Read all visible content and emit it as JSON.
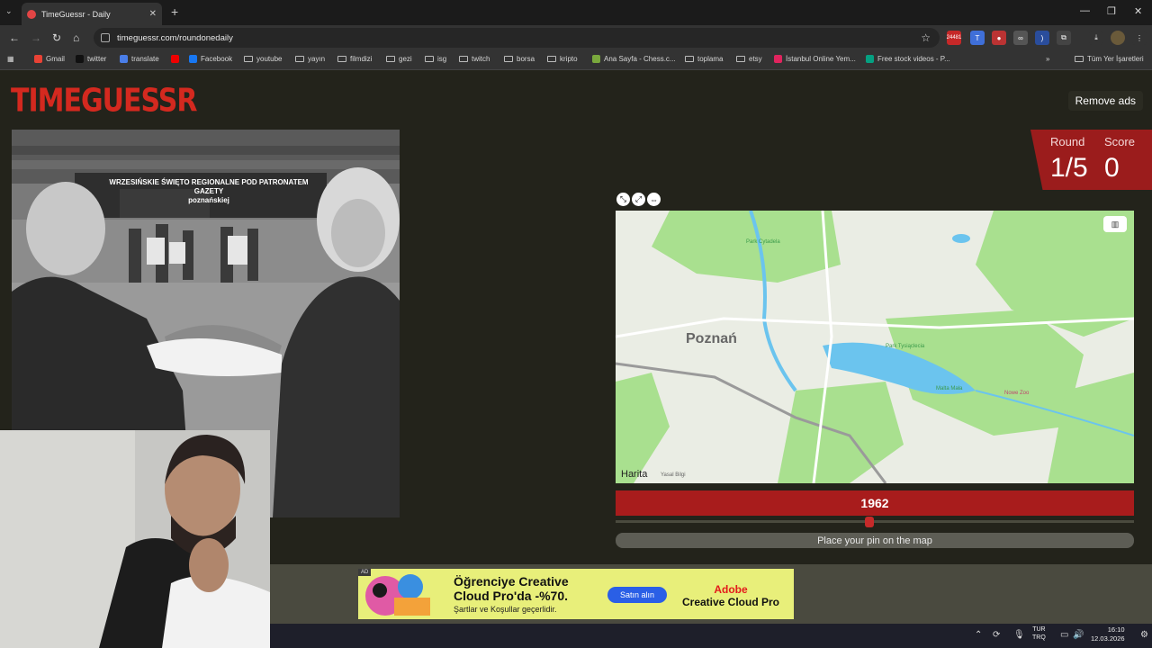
{
  "browser": {
    "tab_title": "TimeGuessr - Daily",
    "url": "timeguessr.com/roundonedaily",
    "new_tab_glyph": "+",
    "tab_close_glyph": "✕",
    "bookmarks": [
      {
        "label": "Gmail",
        "icon": "gmail-icon"
      },
      {
        "label": "twitter",
        "icon": "x-icon"
      },
      {
        "label": "translate",
        "icon": "translate-icon"
      },
      {
        "label": "",
        "icon": "youtube-icon"
      },
      {
        "label": "Facebook",
        "icon": "facebook-icon"
      },
      {
        "label": "youtube",
        "icon": "folder-icon"
      },
      {
        "label": "yayın",
        "icon": "folder-icon"
      },
      {
        "label": "filmdizi",
        "icon": "folder-icon"
      },
      {
        "label": "gezi",
        "icon": "folder-icon"
      },
      {
        "label": "isg",
        "icon": "folder-icon"
      },
      {
        "label": "twitch",
        "icon": "folder-icon"
      },
      {
        "label": "borsa",
        "icon": "folder-icon"
      },
      {
        "label": "kripto",
        "icon": "folder-icon"
      },
      {
        "label": "Ana Sayfa - Chess.c...",
        "icon": "chess-icon"
      },
      {
        "label": "toplama",
        "icon": "folder-icon"
      },
      {
        "label": "etsy",
        "icon": "folder-icon"
      },
      {
        "label": "İstanbul Online Yem...",
        "icon": "yemeksepeti-icon"
      },
      {
        "label": "Free stock videos - P...",
        "icon": "pexels-icon"
      }
    ],
    "all_bookmarks": "Tüm Yer İşaretleri",
    "ext_badge": "24481"
  },
  "game": {
    "logo_text": "TIMEGUESSR",
    "remove_ads": "Remove ads",
    "round_label": "Round",
    "round_value": "1/5",
    "score_label": "Score",
    "score_value": "0",
    "year": "1962",
    "year_slider_fraction": 0.49,
    "guess_button": "Place your pin on the map"
  },
  "photo": {
    "banner_line1": "WRZESIŃSKIE ŚWIĘTO REGIONALNE POD PATRONATEM",
    "banner_line2": "GAZETY",
    "banner_line3": "poznańskiej"
  },
  "map": {
    "city": "Poznań",
    "pois": [
      "Park Cytadela",
      "Park Tysiąclecia",
      "Malta Mała",
      "Nowe Zoo"
    ],
    "attribution": "Harita",
    "legal": "Yasal Bilgi"
  },
  "ad": {
    "tag": "AD",
    "headline": "Öğrenciye Creative Cloud Pro'da -%70.",
    "subline": "Şartlar ve Koşullar geçerlidir.",
    "cta": "Satın alın",
    "brand1": "Adobe",
    "brand2": "Creative Cloud Pro"
  },
  "taskbar": {
    "lang1": "TUR",
    "lang2": "TRQ",
    "time": "16:10",
    "date": "12.03.2026"
  },
  "colors": {
    "brand_red": "#d4291f",
    "panel_red": "#9b1c1c",
    "page_bg": "#23231b"
  }
}
